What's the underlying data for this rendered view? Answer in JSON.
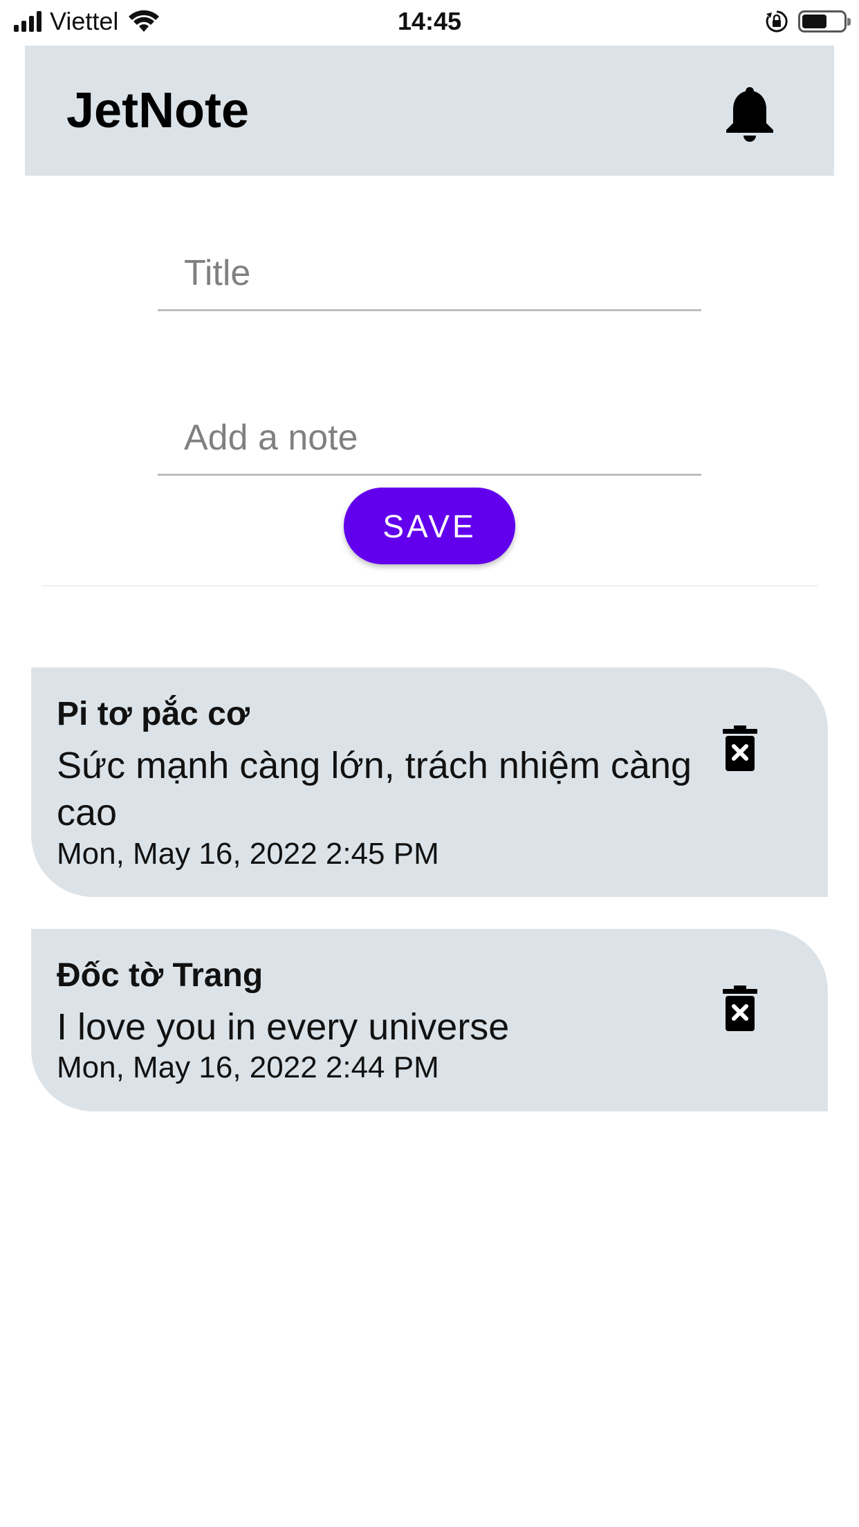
{
  "status_bar": {
    "carrier": "Viettel",
    "time": "14:45",
    "icons": [
      "signal-icon",
      "wifi-icon",
      "rotation-lock-icon",
      "battery-icon"
    ]
  },
  "app_bar": {
    "title": "JetNote",
    "icon": "bell-icon",
    "background": "#dce3e8"
  },
  "form": {
    "title_placeholder": "Title",
    "title_value": "",
    "note_placeholder": "Add a note",
    "note_value": "",
    "save_label": "SAVE",
    "save_color": "#6200ee"
  },
  "notes": [
    {
      "title": "Pi tơ pắc cơ",
      "body": "Sức mạnh càng lớn, trách nhiệm càng cao",
      "date": "Mon, May 16, 2022 2:45 PM",
      "delete_icon": "trash-icon"
    },
    {
      "title": "Đốc tờ Trang",
      "body": "I love you in every universe",
      "date": "Mon, May 16, 2022 2:44 PM",
      "delete_icon": "trash-icon"
    }
  ]
}
